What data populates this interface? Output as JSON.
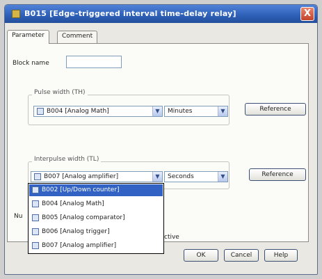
{
  "window": {
    "title": "B015 [Edge-triggered interval time-delay relay]",
    "close": "X"
  },
  "tabs": [
    "Parameter",
    "Comment"
  ],
  "block_name": {
    "label": "Block name",
    "value": ""
  },
  "pulse_width": {
    "legend": "Pulse width (TH)",
    "block": "B004 [Analog Math]",
    "unit": "Minutes",
    "reference_label": "Reference"
  },
  "interpulse_width": {
    "legend": "Interpulse width (TL)",
    "block": "B007 [Analog amplifier]",
    "unit": "Seconds",
    "reference_label": "Reference"
  },
  "dropdown": {
    "items": [
      "B002 [Up/Down counter]",
      "B004 [Analog Math]",
      "B005 [Analog comparator]",
      "B006 [Analog trigger]",
      "B007 [Analog amplifier]"
    ],
    "selected_index": 0
  },
  "partial_labels": {
    "left": "Nu",
    "right": "Active"
  },
  "footer": {
    "ok": "OK",
    "cancel": "Cancel",
    "help": "Help"
  },
  "colors": {
    "titlebar": "#2d5fb6",
    "selection": "#3162c4",
    "dialog_bg": "#e9e8e2"
  }
}
